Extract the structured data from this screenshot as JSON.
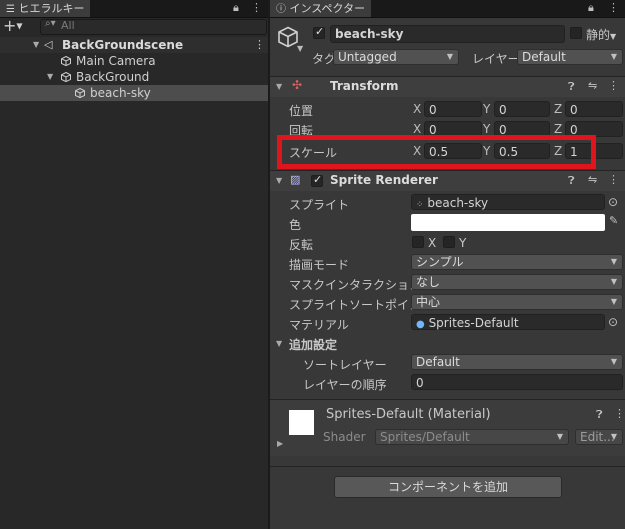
{
  "hierarchy": {
    "tab_label": "ヒエラルキー",
    "add_label": "+",
    "search_placeholder": "All",
    "scene": "BackGroundscene",
    "items": [
      {
        "label": "Main Camera"
      },
      {
        "label": "BackGround"
      },
      {
        "label": "beach-sky"
      }
    ]
  },
  "inspector": {
    "tab_label": "インスペクター",
    "object_name": "beach-sky",
    "static_label": "静的",
    "tag_label": "タグ",
    "tag_value": "Untagged",
    "layer_label": "レイヤー",
    "layer_value": "Default",
    "transform": {
      "title": "Transform",
      "position": {
        "label": "位置",
        "x": "0",
        "y": "0",
        "z": "0"
      },
      "rotation": {
        "label": "回転",
        "x": "0",
        "y": "0",
        "z": "0"
      },
      "scale": {
        "label": "スケール",
        "x": "0.5",
        "y": "0.5",
        "z": "1"
      },
      "axis_x": "X",
      "axis_y": "Y",
      "axis_z": "Z"
    },
    "sprite_renderer": {
      "title": "Sprite Renderer",
      "sprite_label": "スプライト",
      "sprite_value": "beach-sky",
      "color_label": "色",
      "flip_label": "反転",
      "flip_x": "X",
      "flip_y": "Y",
      "draw_mode_label": "描画モード",
      "draw_mode_value": "シンプル",
      "mask_label": "マスクインタラクション",
      "mask_value": "なし",
      "pivot_label": "スプライトソートポイント",
      "pivot_value": "中心",
      "material_label": "マテリアル",
      "material_value": "Sprites-Default",
      "additional_label": "追加設定",
      "sorting_layer_label": "ソートレイヤー",
      "sorting_layer_value": "Default",
      "order_label": "レイヤーの順序",
      "order_value": "0"
    },
    "material": {
      "name": "Sprites-Default (Material)",
      "shader_label": "Shader",
      "shader_value": "Sprites/Default",
      "edit_label": "Edit..."
    },
    "add_component_label": "コンポーネントを追加"
  },
  "colors": {
    "highlight": "#e0141c",
    "panel_bg": "#383838",
    "hierarchy_bg": "#282828"
  }
}
